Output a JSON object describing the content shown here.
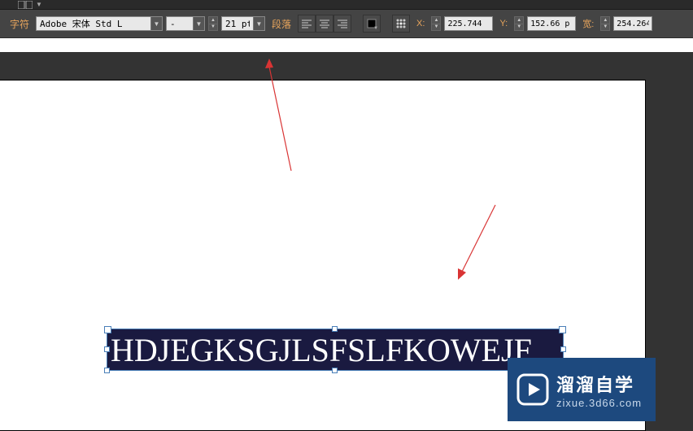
{
  "topbar": {
    "icon": "layout-icon"
  },
  "optionsBar": {
    "charLabel": "字符",
    "fontFamily": "Adobe 宋体 Std L",
    "fontStyle": "-",
    "fontSize": "21 pt",
    "paragraphLabel": "段落",
    "xLabel": "X:",
    "xValue": "225.744",
    "yLabel": "Y:",
    "yValue": "152.66 p",
    "wLabel": "宽:",
    "wValue": "254.264"
  },
  "canvas": {
    "textContent": "HDJEGKSGJLSFSLFKOWEJF"
  },
  "watermark": {
    "title": "溜溜自学",
    "sub": "zixue.3d66.com"
  }
}
